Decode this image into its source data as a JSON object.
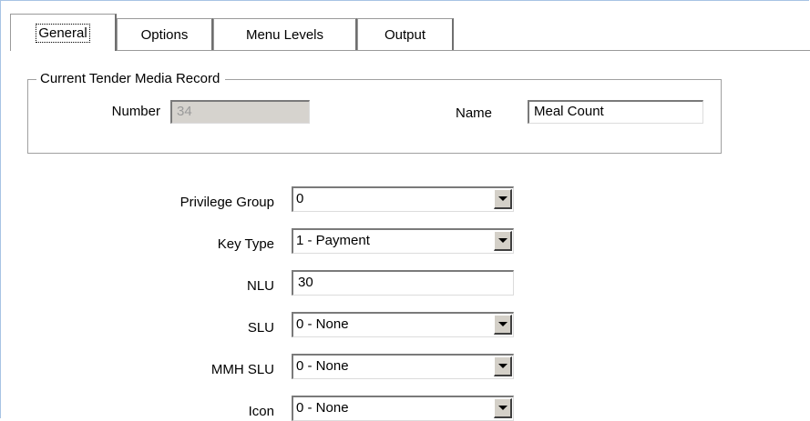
{
  "tabs": [
    {
      "label": "General",
      "active": true
    },
    {
      "label": "Options",
      "active": false
    },
    {
      "label": "Menu Levels",
      "active": false
    },
    {
      "label": "Output",
      "active": false
    }
  ],
  "record_group": {
    "legend": "Current Tender Media Record",
    "number_label": "Number",
    "number_value": "34",
    "name_label": "Name",
    "name_value": "Meal Count"
  },
  "fields": {
    "privilege_group": {
      "label": "Privilege Group",
      "value": "0"
    },
    "key_type": {
      "label": "Key Type",
      "value": "1 - Payment"
    },
    "nlu": {
      "label": "NLU",
      "value": "30"
    },
    "slu": {
      "label": "SLU",
      "value": "0 - None"
    },
    "mmh_slu": {
      "label": "MMH SLU",
      "value": "0 - None"
    },
    "icon": {
      "label": "Icon",
      "value": "0 - None"
    }
  },
  "icons": {
    "dropdown": "chevron-down-icon"
  },
  "colors": {
    "disabled_field": "#d6d3ce",
    "window_border": "#a7c4e4"
  }
}
